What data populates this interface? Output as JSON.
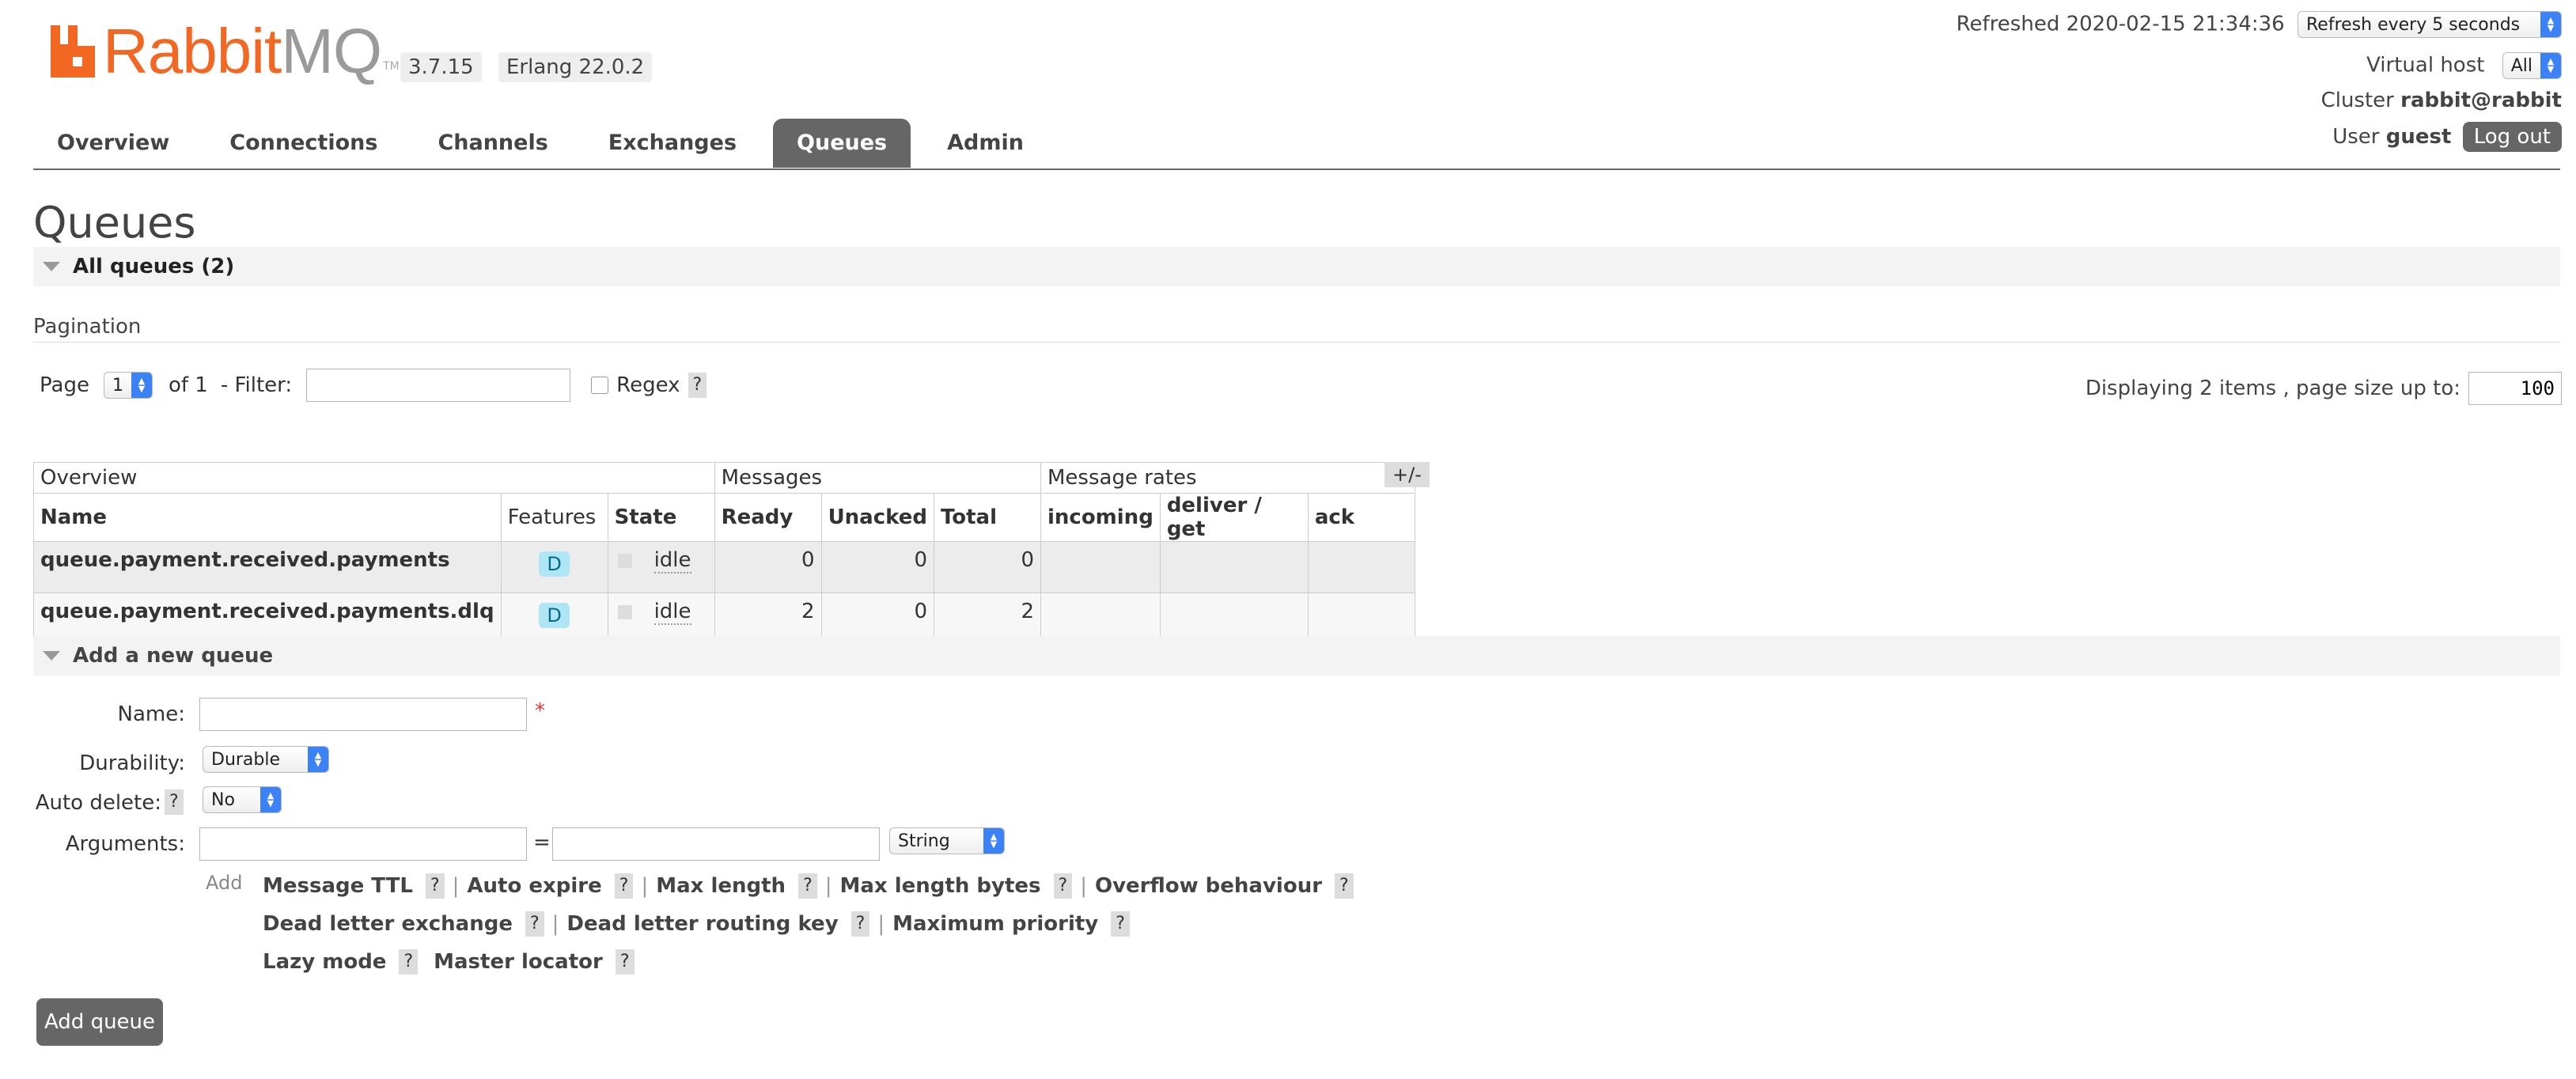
{
  "header": {
    "logo_rabbit": "Rabbit",
    "logo_mq": "MQ",
    "logo_tm": "TM",
    "version": "3.7.15",
    "erlang": "Erlang 22.0.2",
    "refreshed": "Refreshed 2020-02-15 21:34:36",
    "refresh_option": "Refresh every 5 seconds",
    "vhost_label": "Virtual host",
    "vhost_value": "All",
    "cluster_label": "Cluster",
    "cluster_value": "rabbit@rabbit",
    "user_label": "User",
    "user_value": "guest",
    "logout": "Log out"
  },
  "nav": {
    "items": [
      "Overview",
      "Connections",
      "Channels",
      "Exchanges",
      "Queues",
      "Admin"
    ],
    "active": "Queues"
  },
  "page": {
    "title": "Queues",
    "all_queues": "All queues (2)",
    "pagination": "Pagination",
    "page_label": "Page",
    "page_value": "1",
    "of_label": "of 1",
    "filter_label": "- Filter:",
    "filter_value": "",
    "regex_label": "Regex",
    "help": "?",
    "displaying": "Displaying 2 items , page size up to:",
    "page_size": "100"
  },
  "table": {
    "groups": [
      "Overview",
      "Messages",
      "Message rates"
    ],
    "toggle": "+/-",
    "columns": [
      "Name",
      "Features",
      "State",
      "Ready",
      "Unacked",
      "Total",
      "incoming",
      "deliver / get",
      "ack"
    ],
    "rows": [
      {
        "name": "queue.payment.received.payments",
        "feature": "D",
        "state": "idle",
        "ready": "0",
        "unacked": "0",
        "total": "0"
      },
      {
        "name": "queue.payment.received.payments.dlq",
        "feature": "D",
        "state": "idle",
        "ready": "2",
        "unacked": "0",
        "total": "2"
      }
    ]
  },
  "add_queue": {
    "section": "Add a new queue",
    "name_label": "Name:",
    "required": "*",
    "durability_label": "Durability:",
    "durability_value": "Durable",
    "auto_delete_label": "Auto delete:",
    "auto_delete_value": "No",
    "arguments_label": "Arguments:",
    "equals": "=",
    "arg_type": "String",
    "add_label": "Add",
    "args_line1": [
      "Message TTL",
      "Auto expire",
      "Max length",
      "Max length bytes",
      "Overflow behaviour"
    ],
    "args_line2": [
      "Dead letter exchange",
      "Dead letter routing key",
      "Maximum priority"
    ],
    "args_line3": [
      "Lazy mode",
      "Master locator"
    ],
    "separator": "|",
    "submit": "Add queue"
  },
  "colors": {
    "accent": "#f26722",
    "tab_active": "#666666",
    "select_blue": "#3b82f6",
    "durable_badge": "#aee6f6"
  }
}
